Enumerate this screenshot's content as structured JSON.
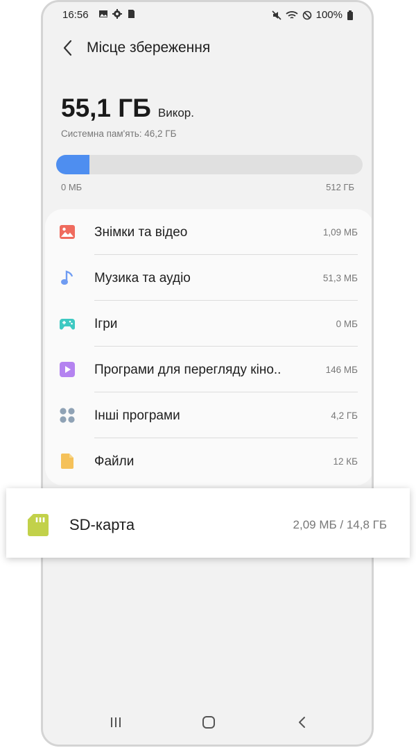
{
  "status": {
    "time": "16:56",
    "battery": "100%"
  },
  "header": {
    "title": "Місце збереження"
  },
  "summary": {
    "used_value": "55,1 ГБ",
    "used_label": "Викор.",
    "system_memory": "Системна пам'ять: 46,2 ГБ",
    "bar_min": "0 МБ",
    "bar_max": "512 ГБ",
    "used_fraction": 0.108,
    "bar_color": "#4e8ef0"
  },
  "categories": [
    {
      "label": "Знімки та відео",
      "size": "1,09 МБ",
      "icon": "image-icon",
      "color": "#ef6b5e"
    },
    {
      "label": "Музика та аудіо",
      "size": "51,3 МБ",
      "icon": "music-note-icon",
      "color": "#6f9cf2"
    },
    {
      "label": "Ігри",
      "size": "0 МБ",
      "icon": "gamepad-icon",
      "color": "#3ec9c2"
    },
    {
      "label": "Програми для перегляду кіно..",
      "size": "146 МБ",
      "icon": "video-play-icon",
      "color": "#b483f0"
    },
    {
      "label": "Інші програми",
      "size": "4,2 ГБ",
      "icon": "apps-grid-icon",
      "color": "#8fa2b5"
    },
    {
      "label": "Файли",
      "size": "12 КБ",
      "icon": "file-icon",
      "color": "#f5c159"
    }
  ],
  "sd_card": {
    "label": "SD-карта",
    "size": "2,09 МБ / 14,8 ГБ",
    "icon": "sd-card-icon",
    "color": "#c2d14a"
  }
}
